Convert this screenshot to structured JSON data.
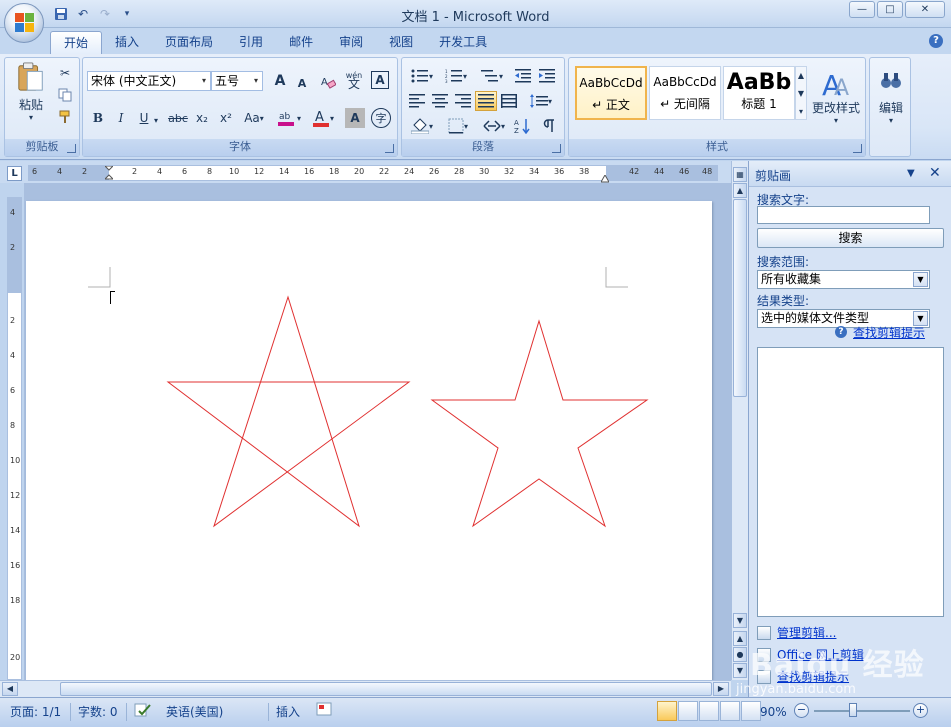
{
  "window": {
    "title": "文档 1 - Microsoft Word",
    "controls": {
      "minimize": "—",
      "maximize": "□",
      "close": "✕"
    }
  },
  "qat": {
    "save_icon": "floppy-icon",
    "undo": "↶",
    "redo": "↷",
    "more": "▾"
  },
  "tabs": [
    {
      "label": "开始",
      "active": true
    },
    {
      "label": "插入"
    },
    {
      "label": "页面布局"
    },
    {
      "label": "引用"
    },
    {
      "label": "邮件"
    },
    {
      "label": "审阅"
    },
    {
      "label": "视图"
    },
    {
      "label": "开发工具"
    }
  ],
  "ribbon": {
    "clipboard": {
      "label": "剪贴板",
      "paste": "粘贴"
    },
    "font": {
      "label": "字体",
      "font_name": "宋体 (中文正文)",
      "font_size": "五号",
      "bold": "B",
      "italic": "I",
      "underline": "U",
      "strike": "abc",
      "sub": "x₂",
      "sup": "x²",
      "case": "Aa",
      "grow": "A",
      "shrink": "A",
      "pinyin": "wén",
      "border_char": "A",
      "shade_char": "A",
      "circle_char": "字"
    },
    "paragraph": {
      "label": "段落"
    },
    "styles": {
      "label": "样式",
      "items": [
        {
          "sample": "AaBbCcDd",
          "name": "↵ 正文",
          "selected": true
        },
        {
          "sample": "AaBbCcDd",
          "name": "↵ 无间隔"
        },
        {
          "sample": "AaBb",
          "name": "标题 1"
        }
      ],
      "change_styles": "更改样式"
    },
    "editing": {
      "label": "编辑"
    }
  },
  "ruler": {
    "corner": "L",
    "ticks": [
      "6",
      "4",
      "2",
      "2",
      "4",
      "6",
      "8",
      "10",
      "12",
      "14",
      "16",
      "18",
      "20",
      "22",
      "24",
      "26",
      "28",
      "30",
      "32",
      "34",
      "36",
      "38",
      "42",
      "44",
      "46",
      "48"
    ],
    "vticks": [
      "4",
      "2",
      "2",
      "4",
      "6",
      "8",
      "10",
      "12",
      "14",
      "16",
      "18",
      "20"
    ]
  },
  "clipboard_pane": {
    "title": "剪贴画",
    "search_label": "搜索文字:",
    "search_value": "",
    "search_button": "搜索",
    "scope_label": "搜索范围:",
    "scope_value": "所有收藏集",
    "type_label": "结果类型:",
    "type_value": "选中的媒体文件类型",
    "tips_link": "查找剪辑提示",
    "organize_link": "管理剪辑...",
    "online_link": "Office 网上剪辑",
    "tips2_link": "查找剪辑提示"
  },
  "statusbar": {
    "page": "页面: 1/1",
    "words": "字数: 0",
    "language": "英语(美国)",
    "mode": "插入",
    "zoom": "90%"
  },
  "drawing": {
    "stroke_color": "#e03030",
    "shapes": [
      "pentagram-star",
      "outline-star"
    ]
  },
  "watermark": {
    "text": "Baidu 经验",
    "sub": "jingyan.baidu.com"
  }
}
